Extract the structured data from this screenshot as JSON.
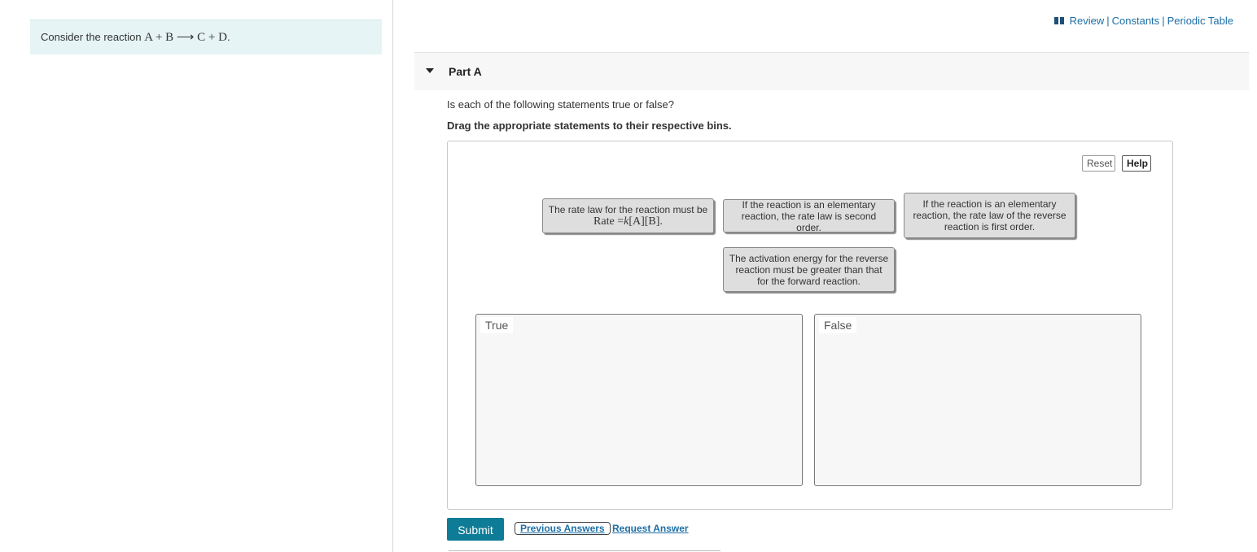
{
  "problem": {
    "intro_prefix": "Consider the reaction ",
    "reaction": "A + B ⟶ C + D",
    "intro_suffix": "."
  },
  "resources": {
    "icon": "book-icon",
    "links": [
      "Review",
      "Constants",
      "Periodic Table"
    ],
    "separator": "|"
  },
  "part": {
    "title": "Part A",
    "question": "Is each of the following statements true or false?",
    "instruction": "Drag the appropriate statements to their respective bins."
  },
  "toolbar": {
    "reset_label": "Reset",
    "help_label": "Help"
  },
  "cards": [
    {
      "line1": "The rate law for the reaction must be",
      "formula_prefix": "Rate =",
      "formula_k": "k",
      "formula_rest": "[A][B]."
    },
    {
      "text": "If the reaction is an elementary reaction, the rate law is second order."
    },
    {
      "text": "If the reaction is an elementary reaction, the rate law of the reverse reaction is first order."
    },
    {
      "text": "The activation energy for the reverse reaction must be greater than that for the forward reaction."
    }
  ],
  "bins": [
    {
      "label": "True"
    },
    {
      "label": "False"
    }
  ],
  "actions": {
    "submit_label": "Submit",
    "previous_answers_label": "Previous Answers",
    "request_answer_label": "Request Answer"
  }
}
